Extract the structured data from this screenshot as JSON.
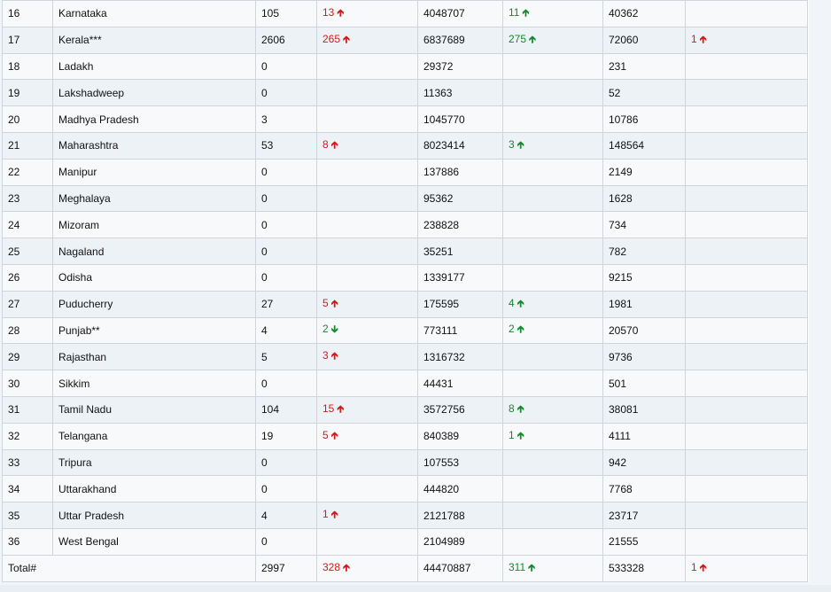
{
  "table": {
    "rows": [
      {
        "sn": "16",
        "state": "Karnataka",
        "c1": "105",
        "c1d": "13",
        "c1dir": "up",
        "c2": "4048707",
        "c2d": "11",
        "c2dir": "up",
        "c3": "40362",
        "c3d": "",
        "c3dir": ""
      },
      {
        "sn": "17",
        "state": "Kerala***",
        "c1": "2606",
        "c1d": "265",
        "c1dir": "up",
        "c2": "6837689",
        "c2d": "275",
        "c2dir": "up",
        "c3": "72060",
        "c3d": "1",
        "c3dir": "up"
      },
      {
        "sn": "18",
        "state": "Ladakh",
        "c1": "0",
        "c1d": "",
        "c1dir": "",
        "c2": "29372",
        "c2d": "",
        "c2dir": "",
        "c3": "231",
        "c3d": "",
        "c3dir": ""
      },
      {
        "sn": "19",
        "state": "Lakshadweep",
        "c1": "0",
        "c1d": "",
        "c1dir": "",
        "c2": "11363",
        "c2d": "",
        "c2dir": "",
        "c3": "52",
        "c3d": "",
        "c3dir": ""
      },
      {
        "sn": "20",
        "state": "Madhya Pradesh",
        "c1": "3",
        "c1d": "",
        "c1dir": "",
        "c2": "1045770",
        "c2d": "",
        "c2dir": "",
        "c3": "10786",
        "c3d": "",
        "c3dir": ""
      },
      {
        "sn": "21",
        "state": "Maharashtra",
        "c1": "53",
        "c1d": "8",
        "c1dir": "up",
        "c2": "8023414",
        "c2d": "3",
        "c2dir": "up",
        "c3": "148564",
        "c3d": "",
        "c3dir": ""
      },
      {
        "sn": "22",
        "state": "Manipur",
        "c1": "0",
        "c1d": "",
        "c1dir": "",
        "c2": "137886",
        "c2d": "",
        "c2dir": "",
        "c3": "2149",
        "c3d": "",
        "c3dir": ""
      },
      {
        "sn": "23",
        "state": "Meghalaya",
        "c1": "0",
        "c1d": "",
        "c1dir": "",
        "c2": "95362",
        "c2d": "",
        "c2dir": "",
        "c3": "1628",
        "c3d": "",
        "c3dir": ""
      },
      {
        "sn": "24",
        "state": "Mizoram",
        "c1": "0",
        "c1d": "",
        "c1dir": "",
        "c2": "238828",
        "c2d": "",
        "c2dir": "",
        "c3": "734",
        "c3d": "",
        "c3dir": ""
      },
      {
        "sn": "25",
        "state": "Nagaland",
        "c1": "0",
        "c1d": "",
        "c1dir": "",
        "c2": "35251",
        "c2d": "",
        "c2dir": "",
        "c3": "782",
        "c3d": "",
        "c3dir": ""
      },
      {
        "sn": "26",
        "state": "Odisha",
        "c1": "0",
        "c1d": "",
        "c1dir": "",
        "c2": "1339177",
        "c2d": "",
        "c2dir": "",
        "c3": "9215",
        "c3d": "",
        "c3dir": ""
      },
      {
        "sn": "27",
        "state": "Puducherry",
        "c1": "27",
        "c1d": "5",
        "c1dir": "up",
        "c2": "175595",
        "c2d": "4",
        "c2dir": "up",
        "c3": "1981",
        "c3d": "",
        "c3dir": ""
      },
      {
        "sn": "28",
        "state": "Punjab**",
        "c1": "4",
        "c1d": "2",
        "c1dir": "down",
        "c2": "773111",
        "c2d": "2",
        "c2dir": "up",
        "c3": "20570",
        "c3d": "",
        "c3dir": ""
      },
      {
        "sn": "29",
        "state": "Rajasthan",
        "c1": "5",
        "c1d": "3",
        "c1dir": "up",
        "c2": "1316732",
        "c2d": "",
        "c2dir": "",
        "c3": "9736",
        "c3d": "",
        "c3dir": ""
      },
      {
        "sn": "30",
        "state": "Sikkim",
        "c1": "0",
        "c1d": "",
        "c1dir": "",
        "c2": "44431",
        "c2d": "",
        "c2dir": "",
        "c3": "501",
        "c3d": "",
        "c3dir": ""
      },
      {
        "sn": "31",
        "state": "Tamil Nadu",
        "c1": "104",
        "c1d": "15",
        "c1dir": "up",
        "c2": "3572756",
        "c2d": "8",
        "c2dir": "up",
        "c3": "38081",
        "c3d": "",
        "c3dir": ""
      },
      {
        "sn": "32",
        "state": "Telangana",
        "c1": "19",
        "c1d": "5",
        "c1dir": "up",
        "c2": "840389",
        "c2d": "1",
        "c2dir": "up",
        "c3": "4111",
        "c3d": "",
        "c3dir": ""
      },
      {
        "sn": "33",
        "state": "Tripura",
        "c1": "0",
        "c1d": "",
        "c1dir": "",
        "c2": "107553",
        "c2d": "",
        "c2dir": "",
        "c3": "942",
        "c3d": "",
        "c3dir": ""
      },
      {
        "sn": "34",
        "state": "Uttarakhand",
        "c1": "0",
        "c1d": "",
        "c1dir": "",
        "c2": "444820",
        "c2d": "",
        "c2dir": "",
        "c3": "7768",
        "c3d": "",
        "c3dir": ""
      },
      {
        "sn": "35",
        "state": "Uttar Pradesh",
        "c1": "4",
        "c1d": "1",
        "c1dir": "up",
        "c2": "2121788",
        "c2d": "",
        "c2dir": "",
        "c3": "23717",
        "c3d": "",
        "c3dir": ""
      },
      {
        "sn": "36",
        "state": "West Bengal",
        "c1": "0",
        "c1d": "",
        "c1dir": "",
        "c2": "2104989",
        "c2d": "",
        "c2dir": "",
        "c3": "21555",
        "c3d": "",
        "c3dir": ""
      }
    ],
    "total": {
      "label": "Total#",
      "c1": "2997",
      "c1d": "328",
      "c1dir": "up",
      "c2": "44470887",
      "c2d": "311",
      "c2dir": "up",
      "c3": "533328",
      "c3d": "1",
      "c3dir": "up"
    }
  },
  "colors": {
    "up_delta_col1": "#d11a1a",
    "up_delta_col2": "#148a2a",
    "up_delta_col3": "#d11a1a",
    "down_delta_col1": "#148a2a"
  },
  "icons": {
    "up": "arrow-up-icon",
    "down": "arrow-down-icon"
  }
}
